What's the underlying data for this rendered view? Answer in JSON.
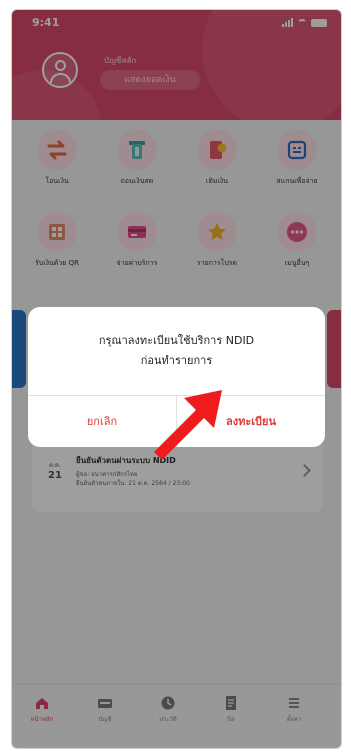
{
  "status_bar": {
    "time": "9:41"
  },
  "header": {
    "account_label": "บัญชีหลัก",
    "show_balance_label": "แสดงยอดเงิน"
  },
  "menu": {
    "row1": [
      {
        "label": "โอนเงิน",
        "icon": "transfer-icon"
      },
      {
        "label": "ถอนเงินสด",
        "icon": "cash-withdraw-icon"
      },
      {
        "label": "เติมเงิน",
        "icon": "topup-icon"
      },
      {
        "label": "สแกนเพื่อจ่าย",
        "icon": "scan-icon"
      }
    ],
    "row2": [
      {
        "label": "รับเงินด้วย QR",
        "icon": "qr-receive-icon"
      },
      {
        "label": "จ่ายค่าบริการ",
        "icon": "bill-card-icon"
      },
      {
        "label": "รายการโปรด",
        "icon": "favorite-star-icon"
      },
      {
        "label": "เมนูอื่นๆ",
        "icon": "more-icon"
      }
    ]
  },
  "notice": {
    "month": "ต.ค.",
    "day": "21",
    "title": "ยืนยันตัวตนผ่านระบบ NDID",
    "line1": "ผู้ขอ: ธนาคารกสิกรไทย",
    "line2": "ยืนยันตัวตนภายใน: 21 ต.ค. 2564 / 23:00"
  },
  "dialog": {
    "message_line1": "กรุณาลงทะเบียนใช้บริการ NDID",
    "message_line2": "ก่อนทำรายการ",
    "cancel_label": "ยกเลิก",
    "confirm_label": "ลงทะเบียน"
  },
  "bottom_nav": [
    {
      "label": "หน้าหลัก",
      "icon": "home-icon",
      "active": true
    },
    {
      "label": "บัญชี",
      "icon": "wallet-icon",
      "active": false
    },
    {
      "label": "ประวัติ",
      "icon": "history-icon",
      "active": false
    },
    {
      "label": "บิล",
      "icon": "bill-icon",
      "active": false
    },
    {
      "label": "ตั้งค่า",
      "icon": "settings-icon",
      "active": false
    }
  ],
  "colors": {
    "brand": "#d94a6a",
    "accent_blue": "#2a76c8",
    "dialog_button": "#e03a3a",
    "arrow": "#ee1c1c"
  }
}
